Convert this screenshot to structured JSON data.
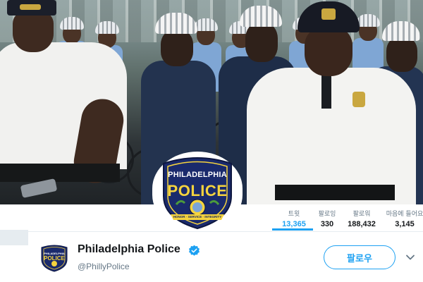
{
  "profile": {
    "display_name": "Philadelphia Police",
    "handle": "@PhillyPolice",
    "verified": true,
    "avatar_badge": {
      "top_text": "PHILADELPHIA",
      "main_text": "POLICE",
      "scroll_text": "HONOR · SERVICE · INTEGRITY"
    },
    "small_logo": {
      "top_text": "PHILADELPHIA",
      "main_text": "POLICE"
    }
  },
  "stats": [
    {
      "label": "트윗",
      "value": "13,365",
      "active": true
    },
    {
      "label": "팔로잉",
      "value": "330",
      "active": false
    },
    {
      "label": "팔로워",
      "value": "188,432",
      "active": false
    },
    {
      "label": "마음에 들어요",
      "value": "3,145",
      "active": false
    }
  ],
  "actions": {
    "follow_label": "팔로우",
    "more_icon": "chevron-down-icon"
  },
  "colors": {
    "accent": "#1da1f2",
    "badge_blue": "#1a2a6c",
    "badge_gold": "#f5d33e"
  }
}
